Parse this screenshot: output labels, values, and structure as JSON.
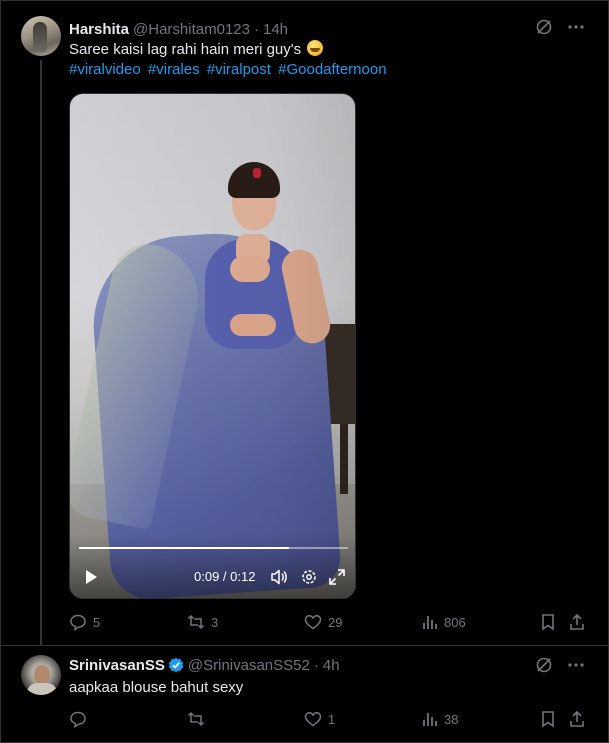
{
  "post": {
    "author_name": "Harshita",
    "author_handle": "@Harshitam0123",
    "dot": "·",
    "time": "14h",
    "text": "Saree kaisi lag rahi hain meri guy's",
    "hashtags": [
      "#viralvideo",
      "#virales",
      "#viralpost",
      "#Goodafternoon"
    ],
    "video": {
      "time_display": "0:09 / 0:12",
      "progress_fraction": 0.78
    },
    "actions": {
      "replies": "5",
      "reposts": "3",
      "likes": "29",
      "views": "806"
    }
  },
  "reply": {
    "author_name": "SrinivasanSS",
    "author_handle": "@SrinivasanSS52",
    "dot": "·",
    "time": "4h",
    "verified": true,
    "text": "aapkaa blouse bahut sexy",
    "actions": {
      "replies": "",
      "reposts": "",
      "likes": "1",
      "views": "38"
    }
  },
  "colors": {
    "background": "#000000",
    "text": "#e7e9ea",
    "muted": "#71767b",
    "link": "#1d9bf0",
    "border": "#2f3336"
  },
  "icons": [
    "grok-icon",
    "more-icon",
    "reply-icon",
    "repost-icon",
    "like-icon",
    "views-icon",
    "bookmark-icon",
    "share-icon",
    "play-icon",
    "volume-icon",
    "settings-icon",
    "fullscreen-icon",
    "verified-icon"
  ]
}
